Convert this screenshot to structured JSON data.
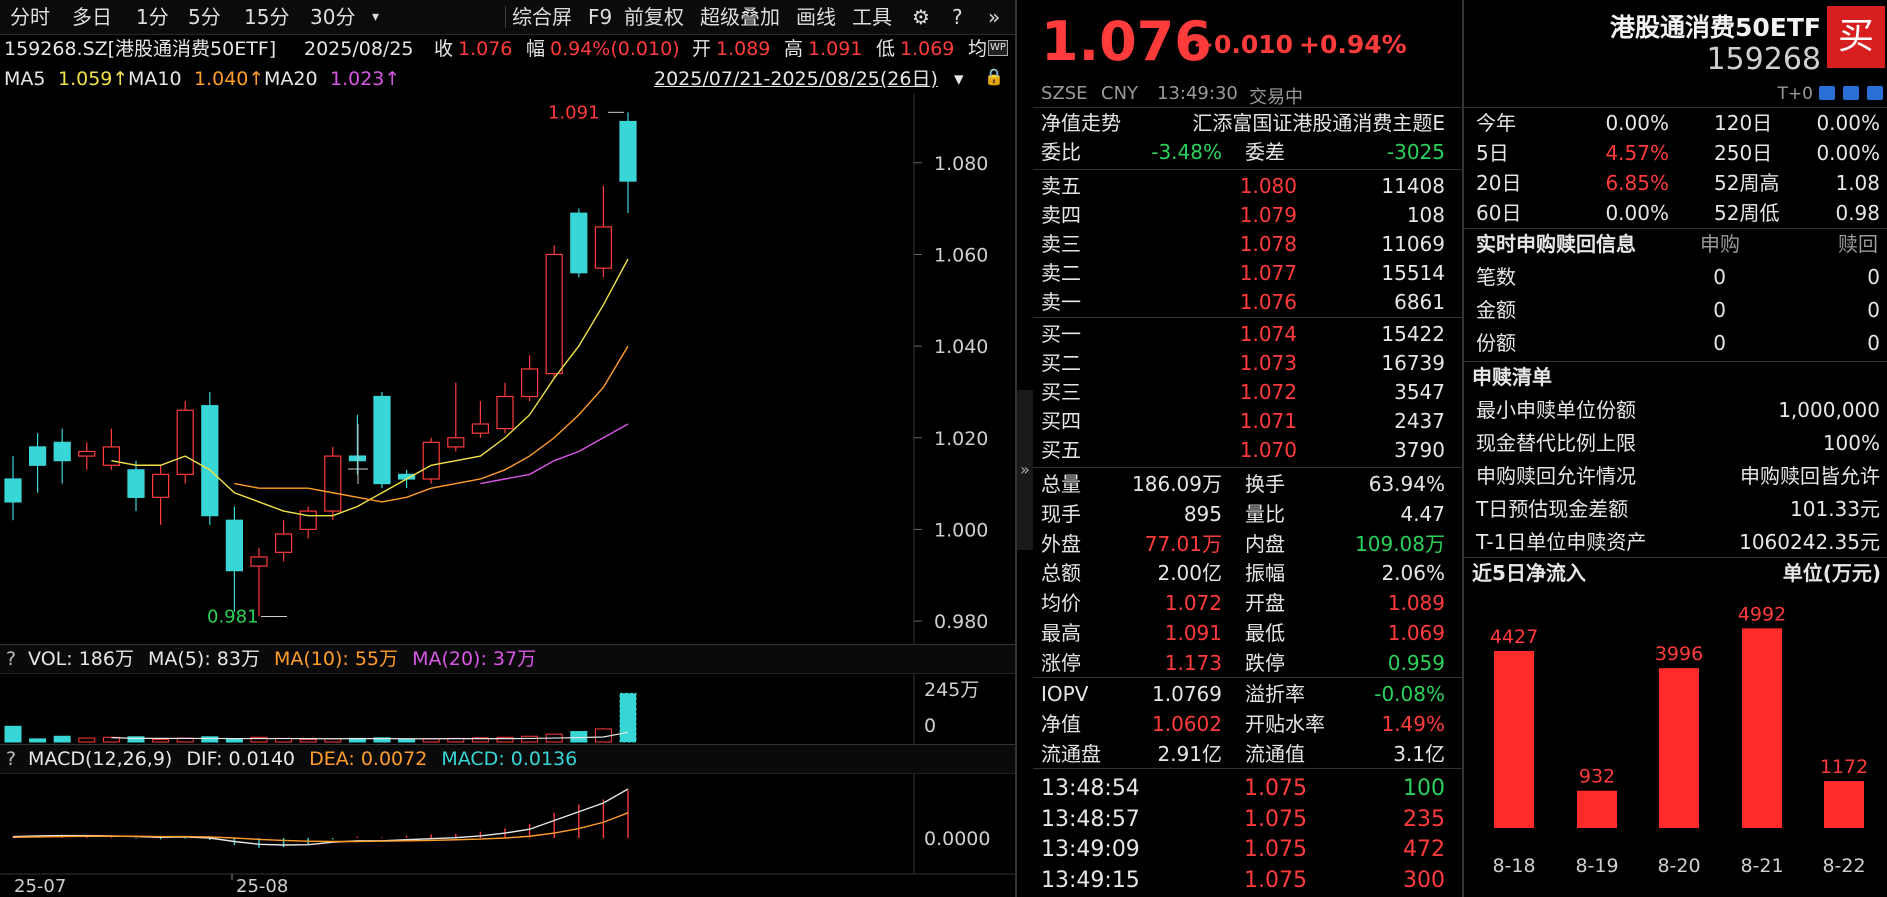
{
  "toolbar": {
    "tabs": [
      "分时",
      "多日",
      "1分",
      "5分",
      "15分",
      "30分"
    ],
    "more_indicator": "▾",
    "right_items": [
      "综合屏",
      "F9",
      "前复权",
      "超级叠加",
      "画线",
      "工具"
    ]
  },
  "quote_line": {
    "code_name": "159268.SZ[港股通消费50ETF]",
    "date": "2025/08/25",
    "close_label": "收",
    "close": "1.076",
    "change_label": "幅",
    "change": "0.94%(0.010)",
    "open_label": "开",
    "open": "1.089",
    "high_label": "高",
    "high": "1.091",
    "low_label": "低",
    "low": "1.069",
    "avg_label": "均",
    "badge": "WP"
  },
  "ma_line": {
    "ma5_label": "MA5",
    "ma5": "1.059↑",
    "ma10_label": "MA10",
    "ma10": "1.040↑",
    "ma20_label": "MA20",
    "ma20": "1.023↑",
    "range": "2025/07/21-2025/08/25(26日)",
    "range_arrow": "▾"
  },
  "chart_data": {
    "type": "candlestick",
    "ylim": [
      0.975,
      1.095
    ],
    "yticks": [
      "1.080",
      "1.060",
      "1.040",
      "1.020",
      "1.000",
      "0.980"
    ],
    "ytick_values": [
      1.08,
      1.06,
      1.04,
      1.02,
      1.0,
      0.98
    ],
    "high_marker": "1.091",
    "low_marker": "0.981",
    "x_labels": [
      "25-07",
      "25-08"
    ],
    "candles": [
      [
        1.011,
        1.006,
        1.016,
        1.002
      ],
      [
        1.018,
        1.014,
        1.021,
        1.008
      ],
      [
        1.019,
        1.015,
        1.022,
        1.01
      ],
      [
        1.016,
        1.017,
        1.019,
        1.013
      ],
      [
        1.014,
        1.018,
        1.022,
        1.013
      ],
      [
        1.013,
        1.007,
        1.015,
        1.004
      ],
      [
        1.007,
        1.012,
        1.014,
        1.001
      ],
      [
        1.012,
        1.026,
        1.028,
        1.01
      ],
      [
        1.027,
        1.003,
        1.03,
        1.001
      ],
      [
        1.002,
        0.991,
        1.005,
        0.982
      ],
      [
        0.992,
        0.994,
        0.996,
        0.981
      ],
      [
        0.995,
        0.999,
        1.002,
        0.993
      ],
      [
        1.0,
        1.004,
        1.005,
        0.998
      ],
      [
        1.004,
        1.016,
        1.018,
        1.002
      ],
      [
        1.016,
        1.015,
        1.025,
        1.012
      ],
      [
        1.029,
        1.01,
        1.03,
        1.009
      ],
      [
        1.012,
        1.011,
        1.013,
        1.009
      ],
      [
        1.011,
        1.019,
        1.02,
        1.01
      ],
      [
        1.018,
        1.02,
        1.032,
        1.017
      ],
      [
        1.021,
        1.023,
        1.028,
        1.02
      ],
      [
        1.022,
        1.029,
        1.032,
        1.021
      ],
      [
        1.029,
        1.035,
        1.038,
        1.028
      ],
      [
        1.034,
        1.06,
        1.062,
        1.033
      ],
      [
        1.069,
        1.056,
        1.07,
        1.055
      ],
      [
        1.057,
        1.066,
        1.075,
        1.055
      ],
      [
        1.089,
        1.076,
        1.091,
        1.069
      ]
    ],
    "ma5": [
      null,
      null,
      null,
      null,
      1.015,
      1.014,
      1.014,
      1.016,
      1.013,
      1.008,
      1.006,
      1.004,
      1.003,
      1.003,
      1.005,
      1.008,
      1.011,
      1.014,
      1.015,
      1.016,
      1.02,
      1.025,
      1.033,
      1.04,
      1.049,
      1.059
    ],
    "ma10": [
      null,
      null,
      null,
      null,
      null,
      null,
      null,
      null,
      null,
      1.01,
      1.009,
      1.009,
      1.009,
      1.008,
      1.007,
      1.006,
      1.007,
      1.009,
      1.01,
      1.011,
      1.013,
      1.016,
      1.02,
      1.025,
      1.031,
      1.04
    ],
    "ma20": [
      null,
      null,
      null,
      null,
      null,
      null,
      null,
      null,
      null,
      null,
      null,
      null,
      null,
      null,
      null,
      null,
      null,
      null,
      null,
      1.01,
      1.011,
      1.012,
      1.015,
      1.017,
      1.02,
      1.023
    ],
    "volume": {
      "header": {
        "vol": "VOL: 186万",
        "ma5": "MA(5): 83万",
        "ma10": "MA(10): 55万",
        "ma20": "MA(20): 37万"
      },
      "ymax_label": "245万",
      "ymin_label": "0",
      "ylim": [
        0,
        245
      ],
      "values": [
        60,
        12,
        22,
        15,
        18,
        20,
        10,
        15,
        20,
        12,
        18,
        14,
        10,
        12,
        14,
        16,
        10,
        12,
        14,
        16,
        18,
        22,
        30,
        40,
        50,
        186
      ]
    },
    "macd": {
      "header": {
        "name": "MACD(12,26,9)",
        "dif": "DIF: 0.0140",
        "dea": "DEA: 0.0072",
        "macd": "MACD: 0.0136"
      },
      "zero_label": "0.0000",
      "dif": [
        0.0004,
        0.0006,
        0.0007,
        0.0007,
        0.0006,
        0.0004,
        0.0002,
        0.0003,
        0.0,
        -0.001,
        -0.0018,
        -0.002,
        -0.0019,
        -0.0012,
        -0.0008,
        -0.0008,
        -0.0005,
        -0.0002,
        0.0001,
        0.0006,
        0.0014,
        0.0025,
        0.005,
        0.0075,
        0.01,
        0.014
      ],
      "dea": [
        0.0002,
        0.0003,
        0.0004,
        0.0005,
        0.0005,
        0.0005,
        0.0004,
        0.0004,
        0.0003,
        0.0,
        -0.0004,
        -0.0007,
        -0.0009,
        -0.001,
        -0.001,
        -0.0009,
        -0.0008,
        -0.0007,
        -0.0005,
        -0.0003,
        0.0,
        0.0005,
        0.0014,
        0.0027,
        0.0045,
        0.0072
      ],
      "ylim": [
        -0.004,
        0.016
      ]
    }
  },
  "header": {
    "price": "1.076",
    "change": "+0.010",
    "change_pct": "+0.94%",
    "name": "港股通消费50ETF",
    "code": "159268",
    "buy_button": "买",
    "exchange": "SZSE",
    "currency": "CNY",
    "time": "13:49:30",
    "status": "交易中",
    "t0": "T+0"
  },
  "book": {
    "nav_label": "净值走势",
    "fund_name": "汇添富国证港股通消费主题E",
    "wb_label": "委比",
    "wb": "-3.48%",
    "wc_label": "委差",
    "wc": "-3025",
    "asks": [
      {
        "label": "卖五",
        "price": "1.080",
        "vol": "11408"
      },
      {
        "label": "卖四",
        "price": "1.079",
        "vol": "108"
      },
      {
        "label": "卖三",
        "price": "1.078",
        "vol": "11069"
      },
      {
        "label": "卖二",
        "price": "1.077",
        "vol": "15514"
      },
      {
        "label": "卖一",
        "price": "1.076",
        "vol": "6861"
      }
    ],
    "bids": [
      {
        "label": "买一",
        "price": "1.074",
        "vol": "15422"
      },
      {
        "label": "买二",
        "price": "1.073",
        "vol": "16739"
      },
      {
        "label": "买三",
        "price": "1.072",
        "vol": "3547"
      },
      {
        "label": "买四",
        "price": "1.071",
        "vol": "2437"
      },
      {
        "label": "买五",
        "price": "1.070",
        "vol": "3790"
      }
    ]
  },
  "stats": [
    [
      {
        "k": "总量",
        "v": "186.09万",
        "c": "white"
      },
      {
        "k": "换手",
        "v": "63.94%",
        "c": "white"
      }
    ],
    [
      {
        "k": "现手",
        "v": "895",
        "c": "white"
      },
      {
        "k": "量比",
        "v": "4.47",
        "c": "white"
      }
    ],
    [
      {
        "k": "外盘",
        "v": "77.01万",
        "c": "red"
      },
      {
        "k": "内盘",
        "v": "109.08万",
        "c": "green"
      }
    ],
    [
      {
        "k": "总额",
        "v": "2.00亿",
        "c": "white"
      },
      {
        "k": "振幅",
        "v": "2.06%",
        "c": "white"
      }
    ],
    [
      {
        "k": "均价",
        "v": "1.072",
        "c": "red"
      },
      {
        "k": "开盘",
        "v": "1.089",
        "c": "red"
      }
    ],
    [
      {
        "k": "最高",
        "v": "1.091",
        "c": "red"
      },
      {
        "k": "最低",
        "v": "1.069",
        "c": "red"
      }
    ],
    [
      {
        "k": "涨停",
        "v": "1.173",
        "c": "red"
      },
      {
        "k": "跌停",
        "v": "0.959",
        "c": "green"
      }
    ]
  ],
  "stats2": [
    [
      {
        "k": "IOPV",
        "v": "1.0769",
        "c": "white"
      },
      {
        "k": "溢折率",
        "v": "-0.08%",
        "c": "green"
      }
    ],
    [
      {
        "k": "净值",
        "v": "1.0602",
        "c": "red"
      },
      {
        "k": "开贴水率",
        "v": "1.49%",
        "c": "red"
      }
    ],
    [
      {
        "k": "流通盘",
        "v": "2.91亿",
        "c": "white"
      },
      {
        "k": "流通值",
        "v": "3.1亿",
        "c": "white"
      }
    ]
  ],
  "ticks": [
    {
      "time": "13:48:54",
      "price": "1.075",
      "vol": "100",
      "c": "green"
    },
    {
      "time": "13:48:57",
      "price": "1.075",
      "vol": "235",
      "c": "red"
    },
    {
      "time": "13:49:09",
      "price": "1.075",
      "vol": "472",
      "c": "red"
    },
    {
      "time": "13:49:15",
      "price": "1.075",
      "vol": "300",
      "c": "red"
    }
  ],
  "perf": [
    [
      {
        "k": "今年",
        "v": "0.00%",
        "c": "white"
      },
      {
        "k": "120日",
        "v": "0.00%",
        "c": "white"
      }
    ],
    [
      {
        "k": "5日",
        "v": "4.57%",
        "c": "red"
      },
      {
        "k": "250日",
        "v": "0.00%",
        "c": "white"
      }
    ],
    [
      {
        "k": "20日",
        "v": "6.85%",
        "c": "red"
      },
      {
        "k": "52周高",
        "v": "1.08",
        "c": "white"
      }
    ],
    [
      {
        "k": "60日",
        "v": "0.00%",
        "c": "white"
      },
      {
        "k": "52周低",
        "v": "0.98",
        "c": "white"
      }
    ]
  ],
  "subscribe": {
    "title": "实时申购赎回信息",
    "col1": "申购",
    "col2": "赎回",
    "rows": [
      {
        "k": "笔数",
        "a": "0",
        "b": "0"
      },
      {
        "k": "金额",
        "a": "0",
        "b": "0"
      },
      {
        "k": "份额",
        "a": "0",
        "b": "0"
      }
    ]
  },
  "list": {
    "title": "申赎清单",
    "rows": [
      {
        "k": "最小申赎单位份额",
        "v": "1,000,000"
      },
      {
        "k": "现金替代比例上限",
        "v": "100%"
      },
      {
        "k": "申购赎回允许情况",
        "v": "申购赎回皆允许"
      },
      {
        "k": "T日预估现金差额",
        "v": "101.33元"
      },
      {
        "k": "T-1日单位申赎资产",
        "v": "1060242.35元"
      }
    ]
  },
  "inflow": {
    "title": "近5日净流入",
    "unit": "单位(万元)",
    "categories": [
      "8-18",
      "8-19",
      "8-20",
      "8-21",
      "8-22"
    ],
    "values": [
      4427,
      932,
      3996,
      4992,
      1172
    ],
    "labels": [
      "4427",
      "932",
      "3996",
      "4992",
      "1172"
    ],
    "ymax": 5000,
    "color": "#ff2a2a"
  },
  "colors": {
    "up": "#ff3b3b",
    "down": "#38d6d6",
    "ma5": "#f0e24a",
    "ma10": "#ff9c2a",
    "ma20": "#d957e6"
  }
}
